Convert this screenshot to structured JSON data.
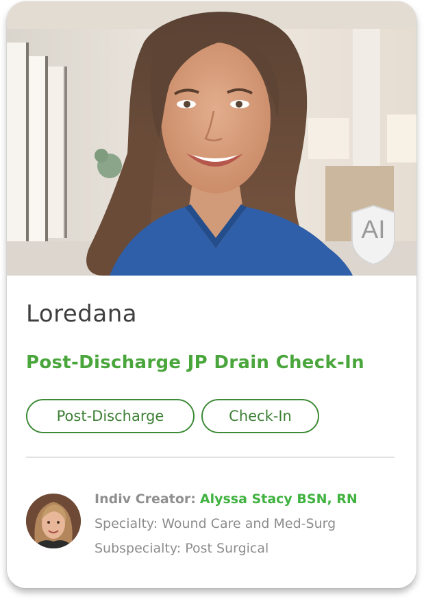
{
  "card": {
    "name": "Loredana",
    "title": "Post-Discharge JP Drain Check-In",
    "ai_badge": "AI",
    "tags": [
      "Post-Discharge",
      "Check-In"
    ],
    "creator": {
      "label": "Indiv Creator:",
      "name": "Alyssa Stacy BSN, RN",
      "specialty": "Specialty: Wound Care and Med-Surg",
      "subspecialty": "Subspecialty: Post Surgical"
    }
  },
  "colors": {
    "accent_green": "#4aa63c",
    "creator_green": "#3fb23f",
    "tag_border": "#3d8b36",
    "scrubs_blue": "#2f5fa8"
  },
  "icons": [
    "ai-shield-icon"
  ]
}
